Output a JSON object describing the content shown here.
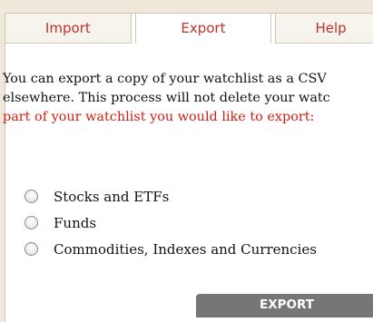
{
  "tabs": [
    {
      "label": "Import",
      "active": false
    },
    {
      "label": "Export",
      "active": true
    },
    {
      "label": "Help",
      "active": false
    }
  ],
  "description": {
    "line1": "You can export a copy of your watchlist as a CSV",
    "line2": "elsewhere. This process will not delete your watc",
    "line3_highlight": "part of your watchlist you would like to export:"
  },
  "options": [
    {
      "label": "Stocks and ETFs",
      "selected": false
    },
    {
      "label": "Funds",
      "selected": false
    },
    {
      "label": "Commodities, Indexes and Currencies",
      "selected": false
    }
  ],
  "export_button": {
    "label": "EXPORT"
  },
  "colors": {
    "background": "#f1e8dc",
    "tab_text": "#c0322a",
    "highlight_text": "#d11c12",
    "button": "#767676"
  }
}
